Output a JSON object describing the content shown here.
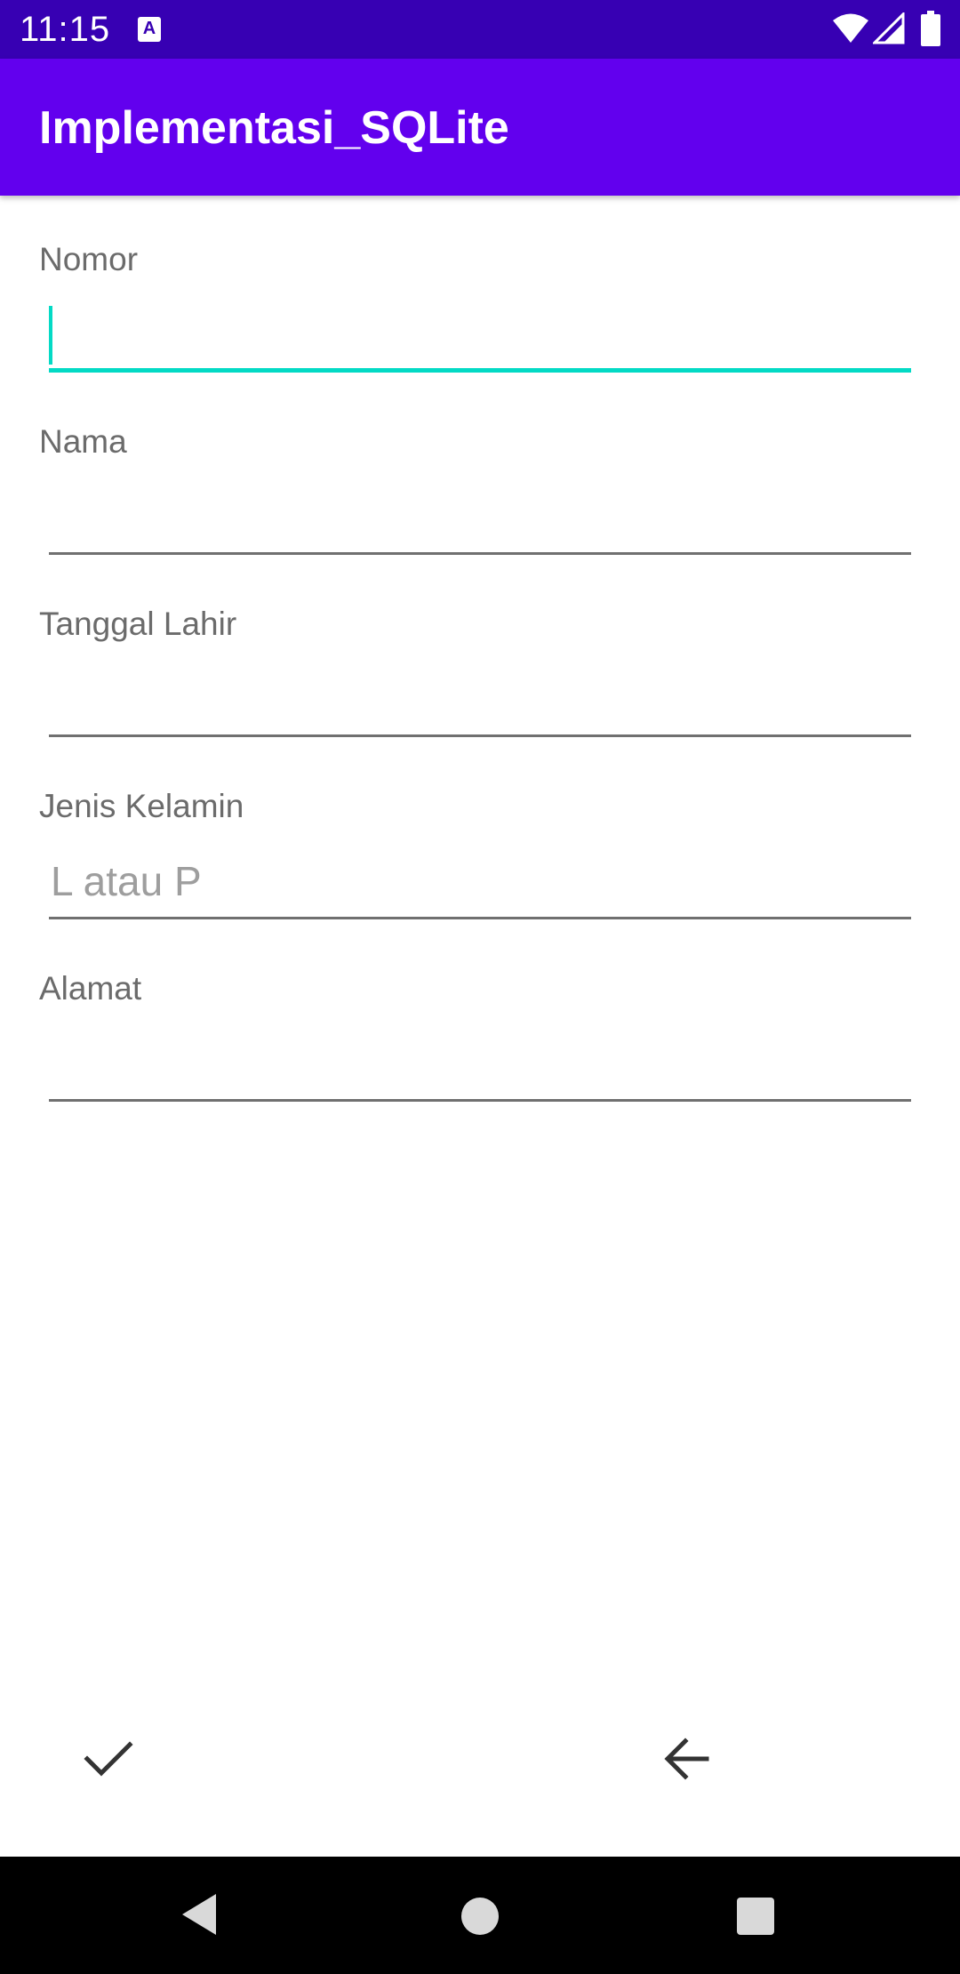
{
  "status_bar": {
    "time": "11:15",
    "notification_icon_letter": "A",
    "icons": [
      "wifi-icon",
      "cellular-signal-icon",
      "battery-icon"
    ]
  },
  "app_bar": {
    "title": "Implementasi_SQLite"
  },
  "form": {
    "nomor": {
      "label": "Nomor",
      "value": "",
      "placeholder": ""
    },
    "nama": {
      "label": "Nama",
      "value": "",
      "placeholder": ""
    },
    "tanggal_lahir": {
      "label": "Tanggal Lahir",
      "value": "",
      "placeholder": ""
    },
    "jenis_kelamin": {
      "label": "Jenis Kelamin",
      "value": "",
      "placeholder": "L atau P"
    },
    "alamat": {
      "label": "Alamat",
      "value": "",
      "placeholder": ""
    }
  },
  "actions": {
    "save_icon": "check-icon",
    "back_icon": "arrow-back-icon"
  },
  "nav_bar": {
    "buttons": [
      "nav-back-icon",
      "nav-home-icon",
      "nav-recents-icon"
    ]
  },
  "colors": {
    "status_bar": "#3700b3",
    "app_bar": "#6200ee",
    "accent": "#03dac5",
    "label_text": "#6b6b6b",
    "underline": "#707070"
  }
}
